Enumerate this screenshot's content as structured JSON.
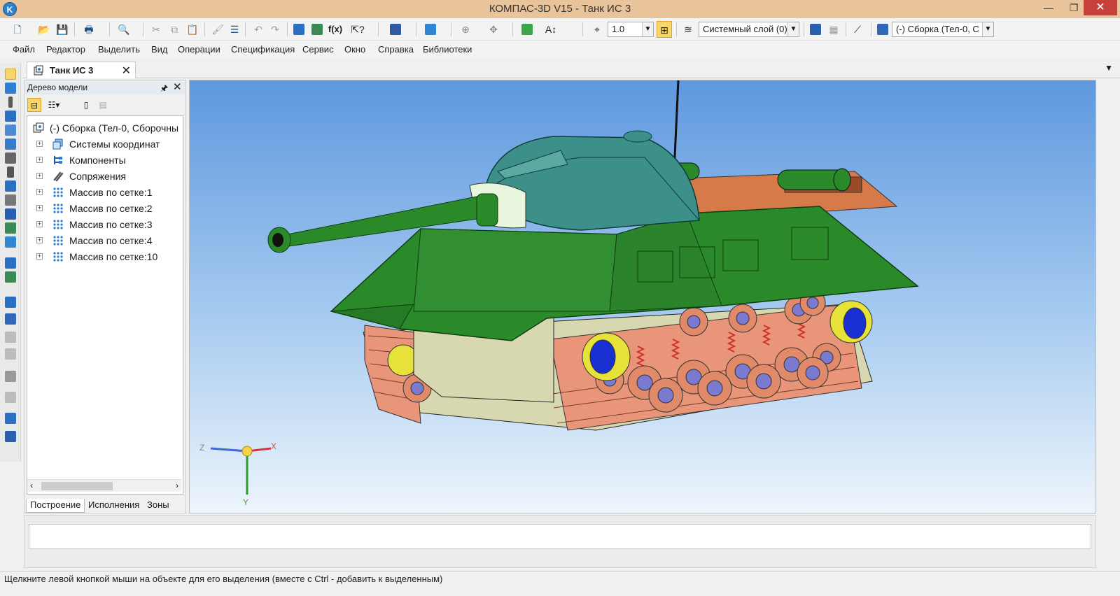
{
  "window": {
    "title": "КОМПАС-3D V15 - Танк ИС 3",
    "app_icon_letter": "K",
    "minimize": "—",
    "maximize": "❐",
    "close": "✕"
  },
  "toolbar": {
    "scale_value": "1.0",
    "layer_value": "Системный слой (0)",
    "assembly_value": "(-) Сборка (Тел-0, С",
    "fx_label": "f(x)"
  },
  "menu": [
    "Файл",
    "Редактор",
    "Выделить",
    "Вид",
    "Операции",
    "Спецификация",
    "Сервис",
    "Окно",
    "Справка",
    "Библиотеки"
  ],
  "document_tab": {
    "label": "Танк ИС 3",
    "close": "✕"
  },
  "model_tree": {
    "title": "Дерево модели",
    "pin": "🖈",
    "close": "✕",
    "root": "(-) Сборка (Тел-0, Сборочны",
    "items": [
      {
        "label": "Системы координат",
        "icon": "coordinate-systems-icon"
      },
      {
        "label": "Компоненты",
        "icon": "components-icon"
      },
      {
        "label": "Сопряжения",
        "icon": "mates-icon"
      },
      {
        "label": "Массив по сетке:1",
        "icon": "grid-array-icon"
      },
      {
        "label": "Массив по сетке:2",
        "icon": "grid-array-icon"
      },
      {
        "label": "Массив по сетке:3",
        "icon": "grid-array-icon"
      },
      {
        "label": "Массив по сетке:4",
        "icon": "grid-array-icon"
      },
      {
        "label": "Массив по сетке:10",
        "icon": "grid-array-icon"
      }
    ],
    "tabs": [
      "Построение",
      "Исполнения",
      "Зоны"
    ]
  },
  "axes": {
    "x": "X",
    "y": "Y",
    "z": "Z"
  },
  "status": {
    "message": "Щелкните левой кнопкой мыши на объекте для его выделения (вместе с Ctrl - добавить к выделенным)"
  },
  "colors": {
    "title_bar": "#e9c49a",
    "hull_green": "#2a8a2a",
    "turret_teal": "#3d8f8a",
    "track_salmon": "#e8957a",
    "wheel_blue": "#1a2fd1"
  }
}
